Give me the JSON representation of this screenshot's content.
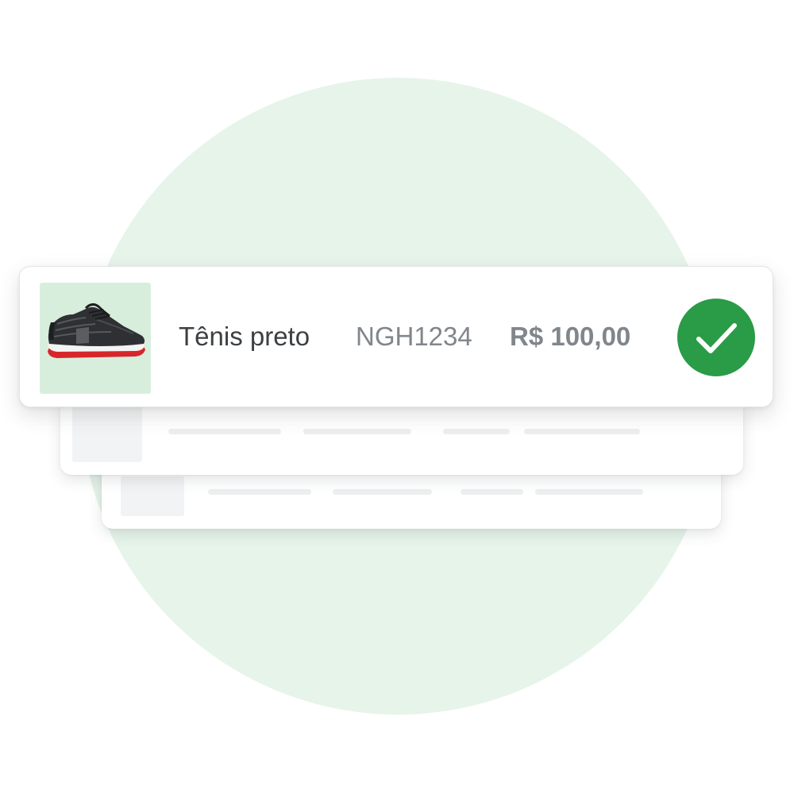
{
  "product": {
    "name": "Tênis preto",
    "sku": "NGH1234",
    "price": "R$ 100,00",
    "image_icon": "sneaker-image",
    "status_icon": "checkmark-icon",
    "thumb_background": "#d8eedd"
  },
  "colors": {
    "background_circle": "#e6f4ea",
    "check_badge": "#2a9b46",
    "placeholder": "#f1f3f4"
  }
}
